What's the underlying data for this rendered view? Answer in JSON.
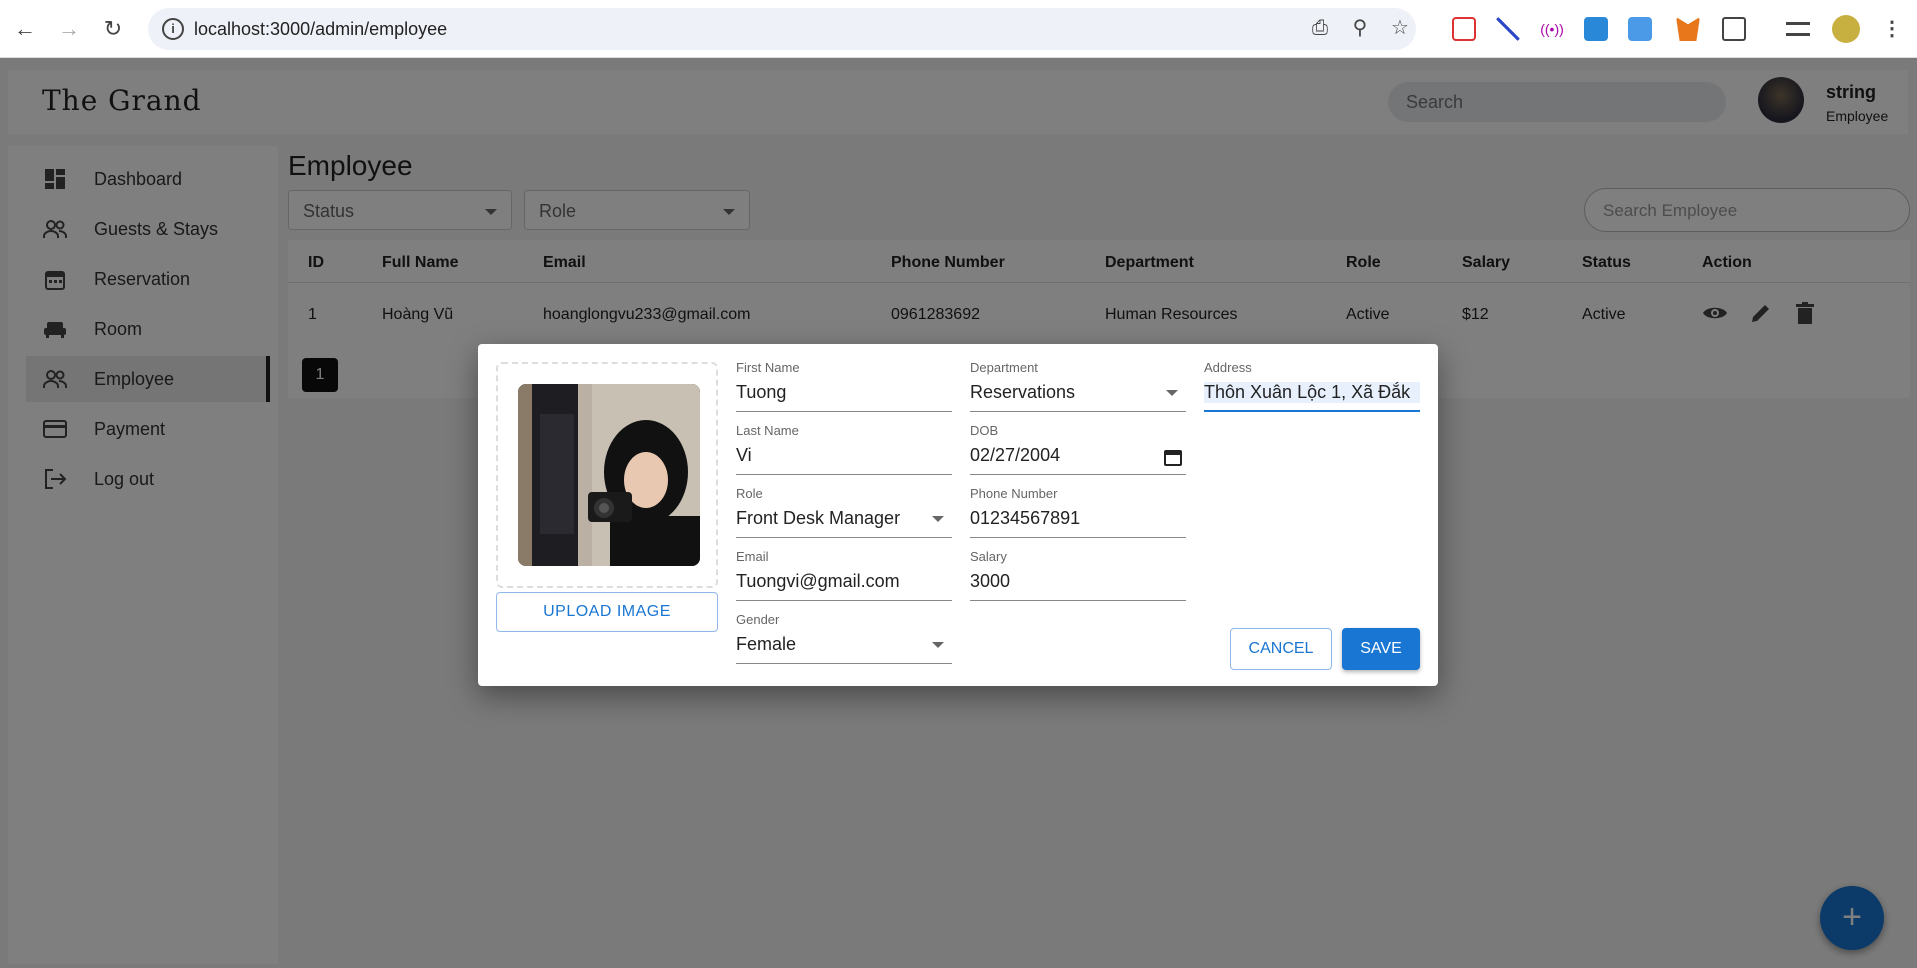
{
  "browser": {
    "url": "localhost:3000/admin/employee"
  },
  "header": {
    "logo": "The Grand",
    "search_placeholder": "Search",
    "user_name": "string",
    "user_role": "Employee"
  },
  "sidebar": {
    "items": [
      {
        "label": "Dashboard",
        "icon": "dashboard-icon"
      },
      {
        "label": "Guests & Stays",
        "icon": "people-icon"
      },
      {
        "label": "Reservation",
        "icon": "calendar-icon"
      },
      {
        "label": "Room",
        "icon": "sofa-icon"
      },
      {
        "label": "Employee",
        "icon": "people-icon",
        "active": true
      },
      {
        "label": "Payment",
        "icon": "card-icon"
      },
      {
        "label": "Log out",
        "icon": "logout-icon"
      }
    ]
  },
  "page": {
    "title": "Employee",
    "filters": {
      "status": "Status",
      "role": "Role"
    },
    "search_placeholder": "Search Employee"
  },
  "table": {
    "columns": [
      "ID",
      "Full Name",
      "Email",
      "Phone Number",
      "Department",
      "Role",
      "Salary",
      "Status",
      "Action"
    ],
    "rows": [
      {
        "id": "1",
        "full_name": "Hoàng Vũ",
        "email": "hoanglongvu233@gmail.com",
        "phone": "0961283692",
        "department": "Human Resources",
        "role": "Active",
        "salary": "$12",
        "status": "Active"
      }
    ]
  },
  "pagination": {
    "current": "1"
  },
  "fab": {
    "label": "+"
  },
  "modal": {
    "upload_label": "UPLOAD IMAGE",
    "fields": {
      "first_name": {
        "label": "First Name",
        "value": "Tuong"
      },
      "last_name": {
        "label": "Last Name",
        "value": "Vi"
      },
      "role": {
        "label": "Role",
        "value": "Front Desk Manager"
      },
      "email": {
        "label": "Email",
        "value": "Tuongvi@gmail.com"
      },
      "gender": {
        "label": "Gender",
        "value": "Female"
      },
      "department": {
        "label": "Department",
        "value": "Reservations"
      },
      "dob": {
        "label": "DOB",
        "value": "02/27/2004"
      },
      "phone": {
        "label": "Phone Number",
        "value": "01234567891"
      },
      "salary": {
        "label": "Salary",
        "value": "3000"
      },
      "address": {
        "label": "Address",
        "value": "Thôn Xuân Lộc 1, Xã Đắk"
      }
    },
    "cancel_label": "CANCEL",
    "save_label": "SAVE"
  },
  "colors": {
    "primary": "#1976d2",
    "overlay": "rgba(0,0,0,0.5)"
  }
}
